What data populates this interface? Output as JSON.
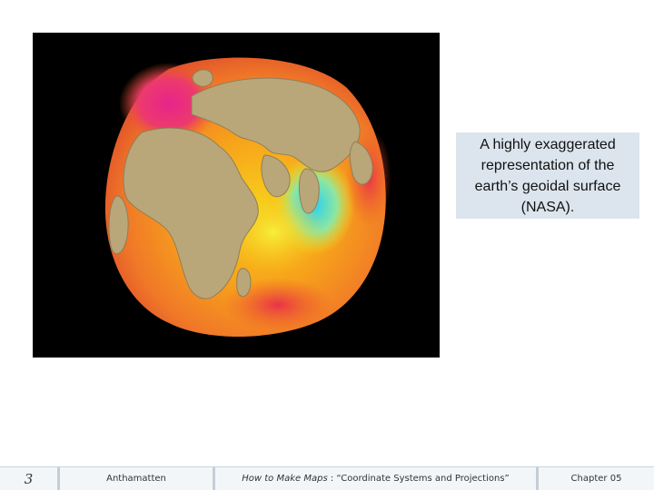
{
  "slide": {
    "caption": "A highly exaggerated representation of the earth’s geoidal surface (NASA).",
    "image": {
      "description_icon": "geoid-image",
      "colors": {
        "background": "#000000",
        "land": "#b9a77a",
        "high": "#e8248c",
        "mid_high": "#f05a28",
        "mid": "#f7a21b",
        "low_mid": "#f5e51a",
        "low": "#2ad1f0"
      }
    }
  },
  "footer": {
    "page_number": "3",
    "author": "Anthamatten",
    "book_title": "How to Make Maps",
    "chapter_subtitle": " : “Coordinate Systems and Projections”",
    "chapter_label": "Chapter 05"
  }
}
